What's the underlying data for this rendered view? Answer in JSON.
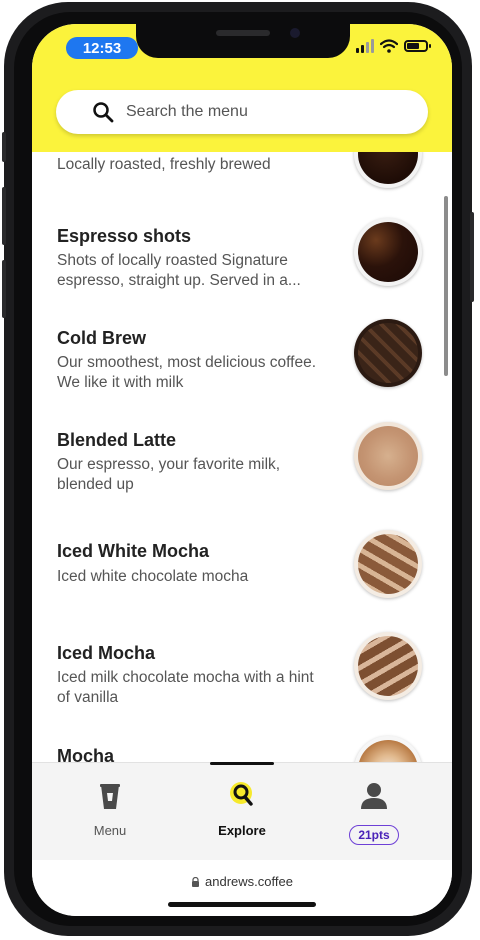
{
  "status_bar": {
    "time": "12:53"
  },
  "search": {
    "placeholder": "Search the menu"
  },
  "menu_items": [
    {
      "name": "",
      "description": "Locally roasted, freshly brewed",
      "image": "brewed-coffee-thumbnail"
    },
    {
      "name": "Espresso shots",
      "description": "Shots of locally roasted Signature espresso, straight up. Served in a...",
      "image": "espresso-thumbnail"
    },
    {
      "name": "Cold Brew",
      "description": "Our smoothest, most delicious coffee. We like it with milk",
      "image": "cold-brew-thumbnail"
    },
    {
      "name": "Blended Latte",
      "description": "Our espresso, your favorite milk, blended up",
      "image": "blended-latte-thumbnail"
    },
    {
      "name": "Iced White Mocha",
      "description": "Iced white chocolate mocha",
      "image": "iced-white-mocha-thumbnail"
    },
    {
      "name": "Iced Mocha",
      "description": "Iced milk chocolate mocha with a hint of vanilla",
      "image": "iced-mocha-thumbnail"
    },
    {
      "name": "Mocha",
      "description": "",
      "image": "mocha-thumbnail"
    }
  ],
  "tabbar": {
    "tabs": [
      {
        "label": "Menu",
        "icon": "cup-icon"
      },
      {
        "label": "Explore",
        "icon": "search-icon"
      },
      {
        "label": "",
        "icon": "user-icon",
        "badge": "21pts"
      }
    ]
  },
  "browser": {
    "url": "andrews.coffee"
  },
  "colors": {
    "accent_yellow": "#fbf33c",
    "time_pill_blue": "#1e77f0",
    "badge_purple": "#6d3fd6"
  }
}
